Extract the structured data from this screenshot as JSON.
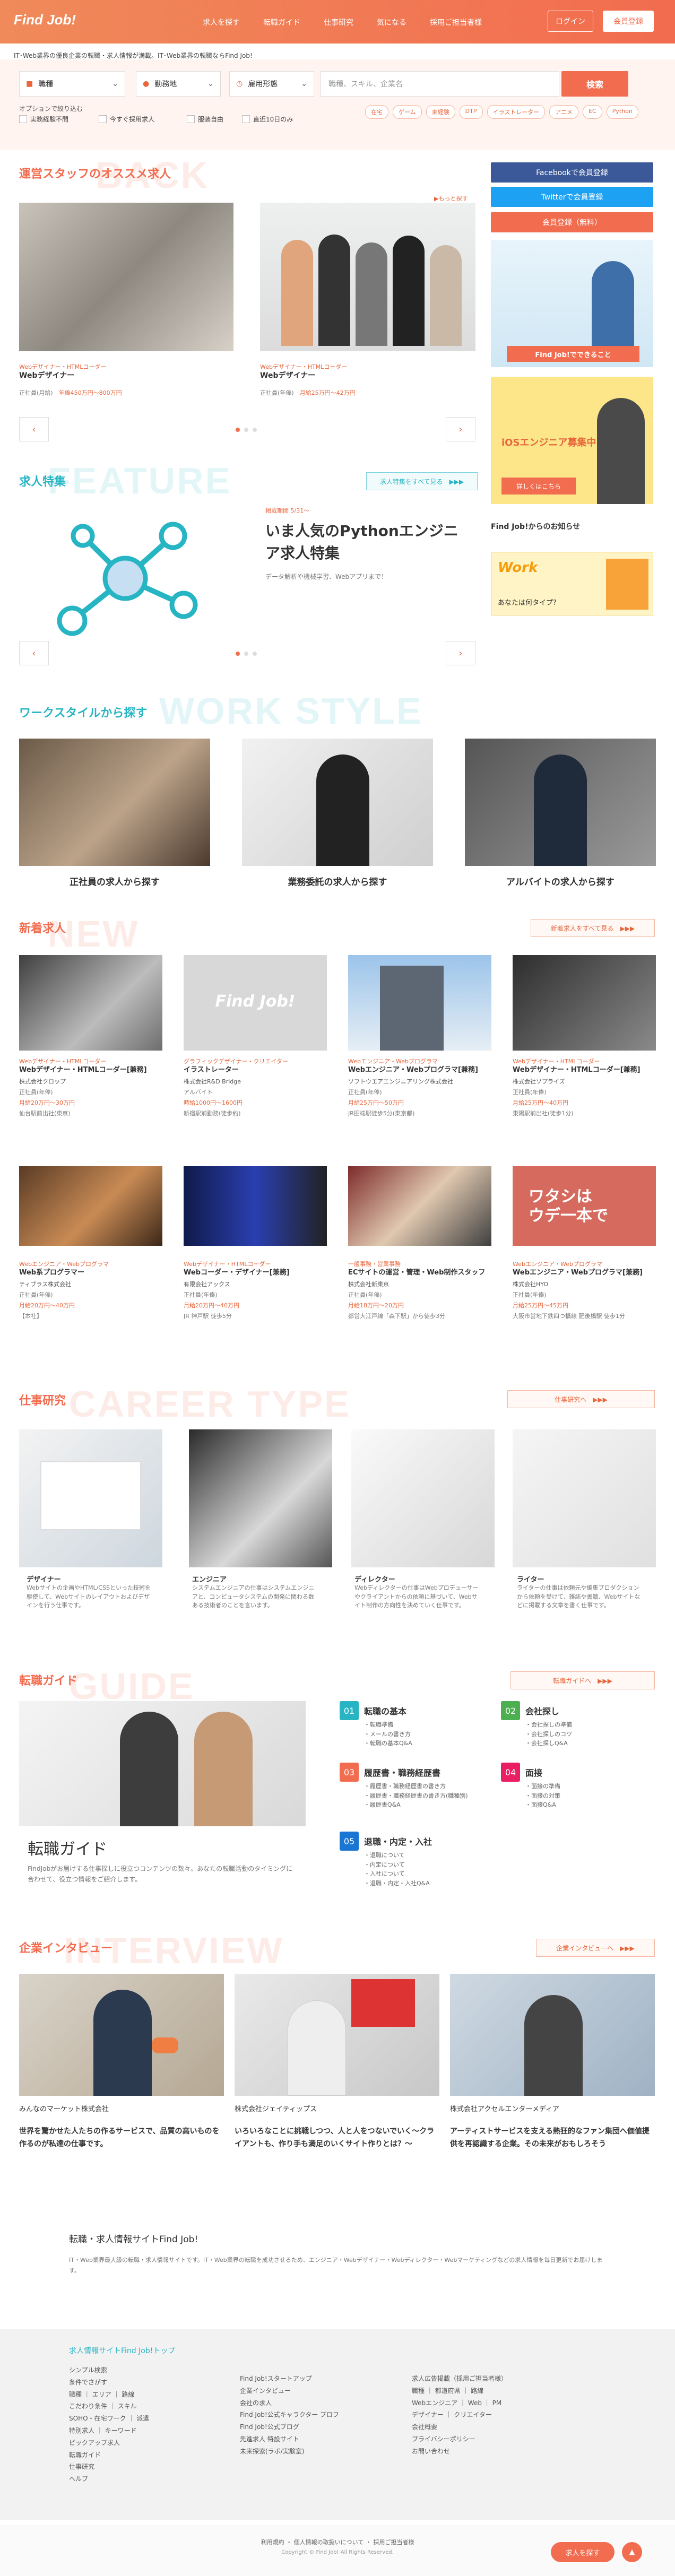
{
  "header": {
    "logo": "Find Job!",
    "nav": [
      "求人を探す",
      "転職ガイド",
      "仕事研究",
      "気になる",
      "採用ご担当者様"
    ],
    "login": "ログイン",
    "register": "会員登録",
    "tagline": "IT･Web業界の優良企業の転職・求人情報が満載。IT･Web業界の転職ならFind Job!"
  },
  "search": {
    "job_type": "職種",
    "location": "勤務地",
    "employment": "雇用形態",
    "keyword_placeholder": "職種、スキル、企業名",
    "button": "検索",
    "options_label": "オプションで絞り込む",
    "options": [
      "実務経験不問",
      "今すぐ採用求人",
      "服装自由",
      "直近10日のみ"
    ],
    "chips": [
      "在宅",
      "ゲーム",
      "未経験",
      "DTP",
      "イラストレーター",
      "アニメ",
      "EC",
      "Python"
    ]
  },
  "sidebar": {
    "facebook": "Facebookで会員登録",
    "twitter": "Twitterで会員登録",
    "email": "会員登録（無料）",
    "ad1_text": "Find Job!でできること",
    "ad2_title": "iOSエンジニア募集中!",
    "ad2_btn": "詳しくはこちら",
    "news": "Find Job!からのお知らせ",
    "ad3_text": "あなたは何タイプ?"
  },
  "recommend": {
    "bg": "BACK",
    "title": "運営スタッフのオススメ求人",
    "more": "▶もっと探す",
    "cards": [
      {
        "category": "Webデザイナー・HTMLコーダー",
        "title": "Webデザイナー",
        "salary": "正社員(月給)",
        "pay": "年俸450万円〜800万円"
      },
      {
        "category": "Webデザイナー・HTMLコーダー",
        "title": "Webデザイナー",
        "salary": "正社員(年俸)",
        "pay": "月給25万円〜42万円"
      }
    ]
  },
  "feature": {
    "bg": "FEATURE",
    "title": "求人特集",
    "more": "求人特集をすべて見る",
    "label": "掲載期間 5/31〜",
    "headline": "いま人気のPythonエンジニア求人特集",
    "desc": "データ解析や機械学習、Webアプリまで！"
  },
  "workstyle": {
    "bg": "WORK STYLE",
    "title": "ワークスタイルから探す",
    "items": [
      "正社員の求人から探す",
      "業務委託の求人から探す",
      "アルバイトの求人から探す"
    ]
  },
  "newjobs": {
    "bg": "NEW",
    "title": "新着求人",
    "more": "新着求人をすべて見る",
    "items": [
      {
        "cat": "Webデザイナー・HTMLコーダー",
        "title": "Webデザイナー・HTMLコーダー[兼務]",
        "co": "株式会社クロップ",
        "l1": "正社員(年俸)",
        "l2": "月給20万円〜30万円",
        "l3": "仙台駅前出社(東京)"
      },
      {
        "cat": "グラフィックデザイナー・クリエイター",
        "title": "イラストレーター",
        "co": "株式会社R&D Bridge",
        "l1": "アルバイト",
        "l2": "時給1000円〜1600円",
        "l3": "新宿駅前勤務(徒歩約)"
      },
      {
        "cat": "Webエンジニア・Webプログラマ",
        "title": "Webエンジニア・Webプログラマ[兼務]",
        "co": "ソフトウエアエンジニアリング株式会社",
        "l1": "正社員(年俸)",
        "l2": "月給25万円〜50万円",
        "l3": "JR田端駅徒歩5分(東京都)"
      },
      {
        "cat": "Webデザイナー・HTMLコーダー",
        "title": "Webデザイナー・HTMLコーダー[兼務]",
        "co": "株式会社ソプライズ",
        "l1": "正社員(年俸)",
        "l2": "月給25万円〜40万円",
        "l3": "東陽駅前出社(徒歩1分)"
      },
      {
        "cat": "Webエンジニア・Webプログラマ",
        "title": "Web系プログラマー",
        "co": "ティブラス株式会社",
        "l1": "正社員(年俸)",
        "l2": "月給20万円〜40万円",
        "l3": "【本社】"
      },
      {
        "cat": "Webデザイナー・HTMLコーダー",
        "title": "Webコーダー・デザイナー[兼務]",
        "co": "有限会社アックス",
        "l1": "正社員(年俸)",
        "l2": "月給20万円〜40万円",
        "l3": "JR 神戸駅 徒歩5分"
      },
      {
        "cat": "一般事務・営業事務",
        "title": "ECサイトの運営・管理・Web制作スタッフ",
        "co": "株式会社新東京",
        "l1": "正社員(年俸)",
        "l2": "月給18万円〜20万円",
        "l3": "都営大江戸線「森下駅」から徒歩3分"
      },
      {
        "cat": "Webエンジニア・Webプログラマ",
        "title": "Webエンジニア・Webプログラマ[兼務]",
        "co": "株式会社HYO",
        "l1": "正社員(年俸)",
        "l2": "月給25万円〜45万円",
        "l3": "大阪市営地下鉄四つ橋線 肥後橋駅 徒歩1分"
      }
    ]
  },
  "research": {
    "bg": "CAREER TYPE",
    "title": "仕事研究",
    "more": "仕事研究へ",
    "items": [
      {
        "name": "デザイナー",
        "desc": "Webサイトの企画やHTML/CSSといった技術を駆使して、Webサイトのレイアウトおよびデザインを行う仕事です。"
      },
      {
        "name": "エンジニア",
        "desc": "システムエンジニアの仕事はシステムエンジニアと、コンピュータシステムの開発に関わる数ある技術者のことを言います。"
      },
      {
        "name": "ディレクター",
        "desc": "Webディレクターの仕事はWebプロデューサーやクライアントからの依頼に基づいて、Webサイト制作の方向性を決めていく仕事です。"
      },
      {
        "name": "ライター",
        "desc": "ライターの仕事は依頼元や編集プロダクションから依頼を受けて、雑誌や書籍、Webサイトなどに掲載する文章を書く仕事です。"
      }
    ]
  },
  "guide": {
    "bg": "GUIDE",
    "title": "転職ガイド",
    "more": "転職ガイドへ",
    "heading": "転職ガイド",
    "desc": "FindJobがお届けする仕事探しに役立つコンテンツの数々。あなたの転職活動のタイミングに合わせて、役立つ情報をご紹介します。",
    "items": [
      {
        "num": "01",
        "title": "転職の基本",
        "lines": [
          "・転職準備",
          "・メールの書き方",
          "・転職の基本Q&A"
        ]
      },
      {
        "num": "02",
        "title": "会社探し",
        "lines": [
          "・会社探しの準備",
          "・会社探しのコツ",
          "・会社探しQ&A"
        ]
      },
      {
        "num": "03",
        "title": "履歴書・職務経歴書",
        "lines": [
          "・履歴書・職務経歴書の書き方",
          "・履歴書・職務経歴書の書き方(職種別)",
          "・履歴書Q&A"
        ]
      },
      {
        "num": "04",
        "title": "面接",
        "lines": [
          "・面接の準備",
          "・面接の対策",
          "・面接Q&A"
        ]
      },
      {
        "num": "05",
        "title": "退職・内定・入社",
        "lines": [
          "・退職について",
          "・内定について",
          "・入社について",
          "・退職・内定・入社Q&A"
        ]
      }
    ]
  },
  "interview": {
    "bg": "INTERVIEW",
    "title": "企業インタビュー",
    "more": "企業インタビューへ",
    "items": [
      {
        "company": "みんなのマーケット株式会社",
        "text": "世界を驚かせた人たちの作るサービスで、品質の高いものを作るのが私達の仕事です。"
      },
      {
        "company": "株式会社ジェイティップス",
        "text": "いろいろなことに挑戦しつつ、人と人をつないでいく〜クライアントも、作り手も満足のいくサイト作りとは？〜"
      },
      {
        "company": "株式会社アクセルエンターメディア",
        "text": "アーティストサービスを支える熱狂的なファン集団へ価値提供を再認識する企業。その未来がおもしろそう"
      }
    ]
  },
  "about": {
    "title": "転職・求人情報サイトFind Job!",
    "text": "IT・Web業界最大級の転職・求人情報サイトです。IT・Web業界の転職を成功させるため、エンジニア・Webデザイナー・Webディレクター・Webマーケティングなどの求人情報を毎日更新でお届けします。"
  },
  "footer": {
    "title": "求人情報サイトFind Job!トップ",
    "col1": [
      "シンプル検索",
      "条件でさがす",
      "職種 ｜ エリア ｜ 路線",
      "こだわり条件 ｜ スキル",
      "SOHO・在宅ワーク ｜ 派遣",
      "特別求人 ｜ キーワード",
      "ピックアップ求人",
      "転職ガイド",
      "仕事研究",
      "ヘルプ"
    ],
    "col2": [
      "Find Job!スタートアップ",
      "企業インタビュー",
      "会社の求人",
      "Find Job!公式キャラクター プロフ",
      "Find Job!公式ブログ",
      "先進求人 特設サイト",
      "未来探索(ラボ/実験室)"
    ],
    "col3": [
      "求人広告掲載（採用ご担当者様）",
      "職種 ｜ 都道府県 ｜ 路線",
      "Webエンジニア ｜ Web ｜ PM",
      "デザイナー ｜ クリエイター",
      "会社概要",
      "プライバシーポリシー",
      "お問い合わせ"
    ]
  },
  "bottom": {
    "links": "利用規約 ・ 個人情報の取扱いについて ・ 採用ご担当者様",
    "copyright": "Copyright © Find Job! All Rights Reserved.",
    "pagetop": "求人を探す"
  }
}
